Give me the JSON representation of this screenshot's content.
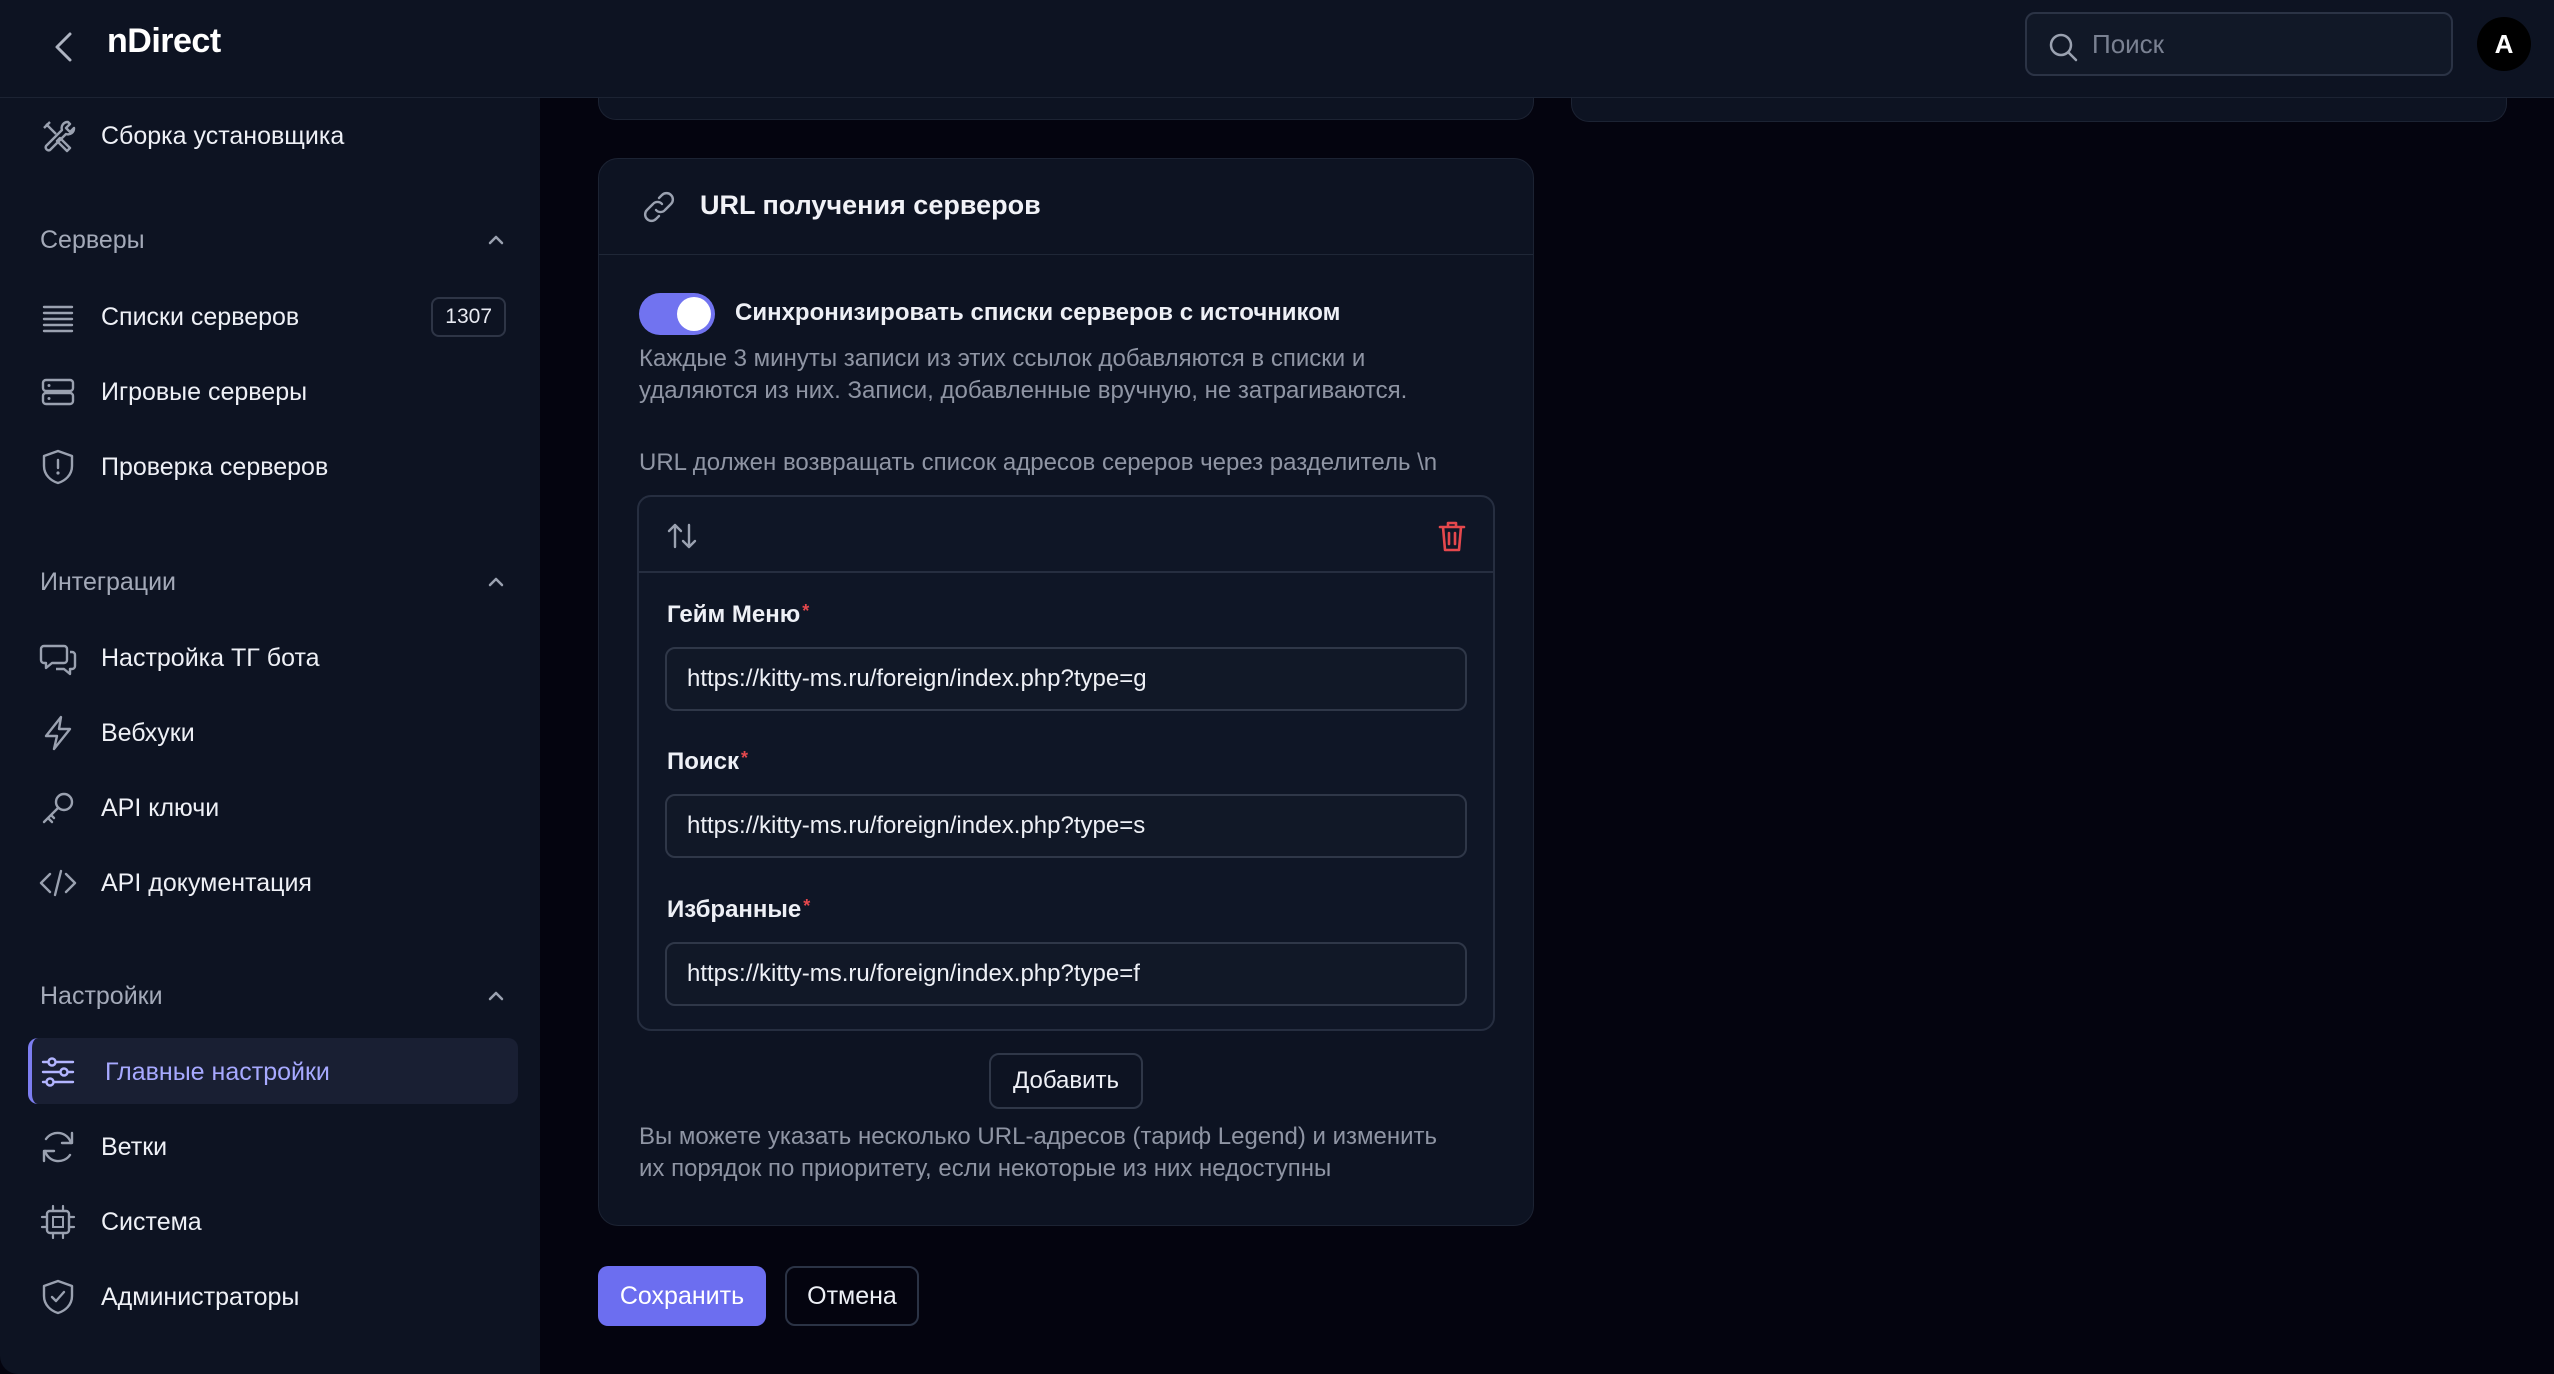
{
  "app": {
    "title": "nDirect"
  },
  "search": {
    "placeholder": "Поиск"
  },
  "user": {
    "avatar_letter": "A"
  },
  "sidebar": {
    "top_item": {
      "label": "Сборка установщика",
      "icon": "tools-icon"
    },
    "sections": [
      {
        "title": "Серверы",
        "expanded": true,
        "items": [
          {
            "label": "Списки серверов",
            "icon": "list-icon",
            "badge": "1307"
          },
          {
            "label": "Игровые серверы",
            "icon": "server-icon"
          },
          {
            "label": "Проверка серверов",
            "icon": "shield-alert-icon"
          }
        ]
      },
      {
        "title": "Интеграции",
        "expanded": true,
        "items": [
          {
            "label": "Настройка ТГ бота",
            "icon": "chat-icon"
          },
          {
            "label": "Вебхуки",
            "icon": "lightning-icon"
          },
          {
            "label": "API ключи",
            "icon": "key-icon"
          },
          {
            "label": "API документация",
            "icon": "code-icon"
          }
        ]
      },
      {
        "title": "Настройки",
        "expanded": true,
        "items": [
          {
            "label": "Главные настройки",
            "icon": "sliders-icon",
            "active": true
          },
          {
            "label": "Ветки",
            "icon": "refresh-icon"
          },
          {
            "label": "Система",
            "icon": "cpu-icon"
          },
          {
            "label": "Администраторы",
            "icon": "shield-check-icon"
          }
        ]
      }
    ]
  },
  "card": {
    "title": "URL получения серверов",
    "toggle": {
      "label": "Синхронизировать списки серверов с источником",
      "on": true
    },
    "description_line1": "Каждые 3 минуты записи из этих ссылок добавляются в списки и",
    "description_line2": "удаляются из них. Записи, добавленные вручную, не затрагиваются.",
    "url_hint": "URL должен возвращать список адресов сереров через разделитель \\n",
    "fields": [
      {
        "label": "Гейм Меню",
        "required_mark": "*",
        "value": "https://kitty-ms.ru/foreign/index.php?type=g"
      },
      {
        "label": "Поиск",
        "required_mark": "*",
        "value": "https://kitty-ms.ru/foreign/index.php?type=s"
      },
      {
        "label": "Избранные",
        "required_mark": "*",
        "value": "https://kitty-ms.ru/foreign/index.php?type=f"
      }
    ],
    "add_label": "Добавить",
    "footer_line1": "Вы можете указать несколько URL-адресов (тариф Legend) и изменить",
    "footer_line2": "их порядок по приоритету, если некоторые из них недоступны"
  },
  "actions": {
    "save_label": "Сохранить",
    "cancel_label": "Отмена"
  },
  "colors": {
    "accent": "#6c6ef0",
    "active_text": "#a7a9ff",
    "danger": "#e5484d",
    "background": "#04040f",
    "panel": "#0d1322"
  }
}
